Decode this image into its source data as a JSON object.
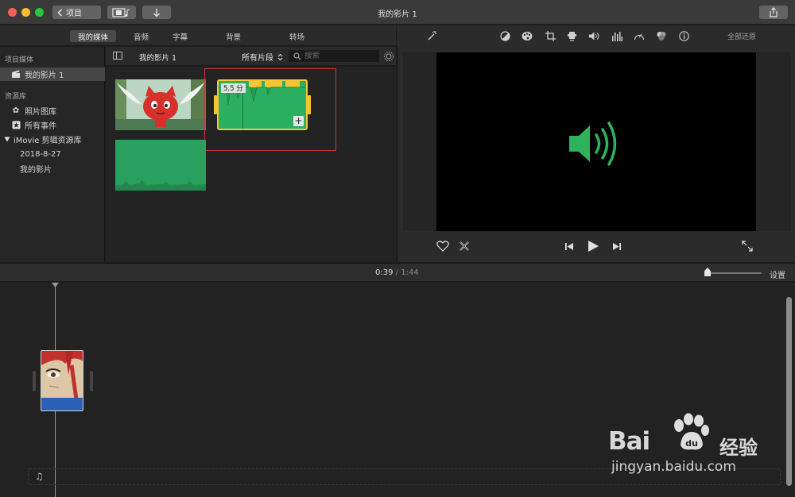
{
  "window": {
    "title": "我的影片 1",
    "back_label": "项目"
  },
  "media_tabs": [
    "我的媒体",
    "音频",
    "字幕",
    "背景",
    "转场"
  ],
  "sidebar": {
    "section_project": "项目媒体",
    "project_item": "我的影片 1",
    "section_library": "资源库",
    "library_items": [
      "照片图库",
      "所有事件"
    ],
    "imovie_library": "iMovie 剪辑资源库",
    "events": [
      "2018-8-27",
      "我的影片"
    ]
  },
  "browser": {
    "title": "我的影片 1",
    "filter": "所有片段",
    "search_placeholder": "搜索",
    "selected_clip_duration": "5.5 分"
  },
  "viewer": {
    "restore_label": "全部还原"
  },
  "timeline": {
    "current_time": "0:39",
    "separator": "/",
    "total_time": "1:44",
    "settings_label": "设置"
  },
  "watermark": {
    "brand": "Bai",
    "brand_suffix": "经验",
    "url": "jingyan.baidu.com"
  },
  "colors": {
    "audio_clip": "#2bb062",
    "selection": "#f6c531",
    "highlight_box": "#d0343b",
    "speaker": "#2db35d"
  }
}
